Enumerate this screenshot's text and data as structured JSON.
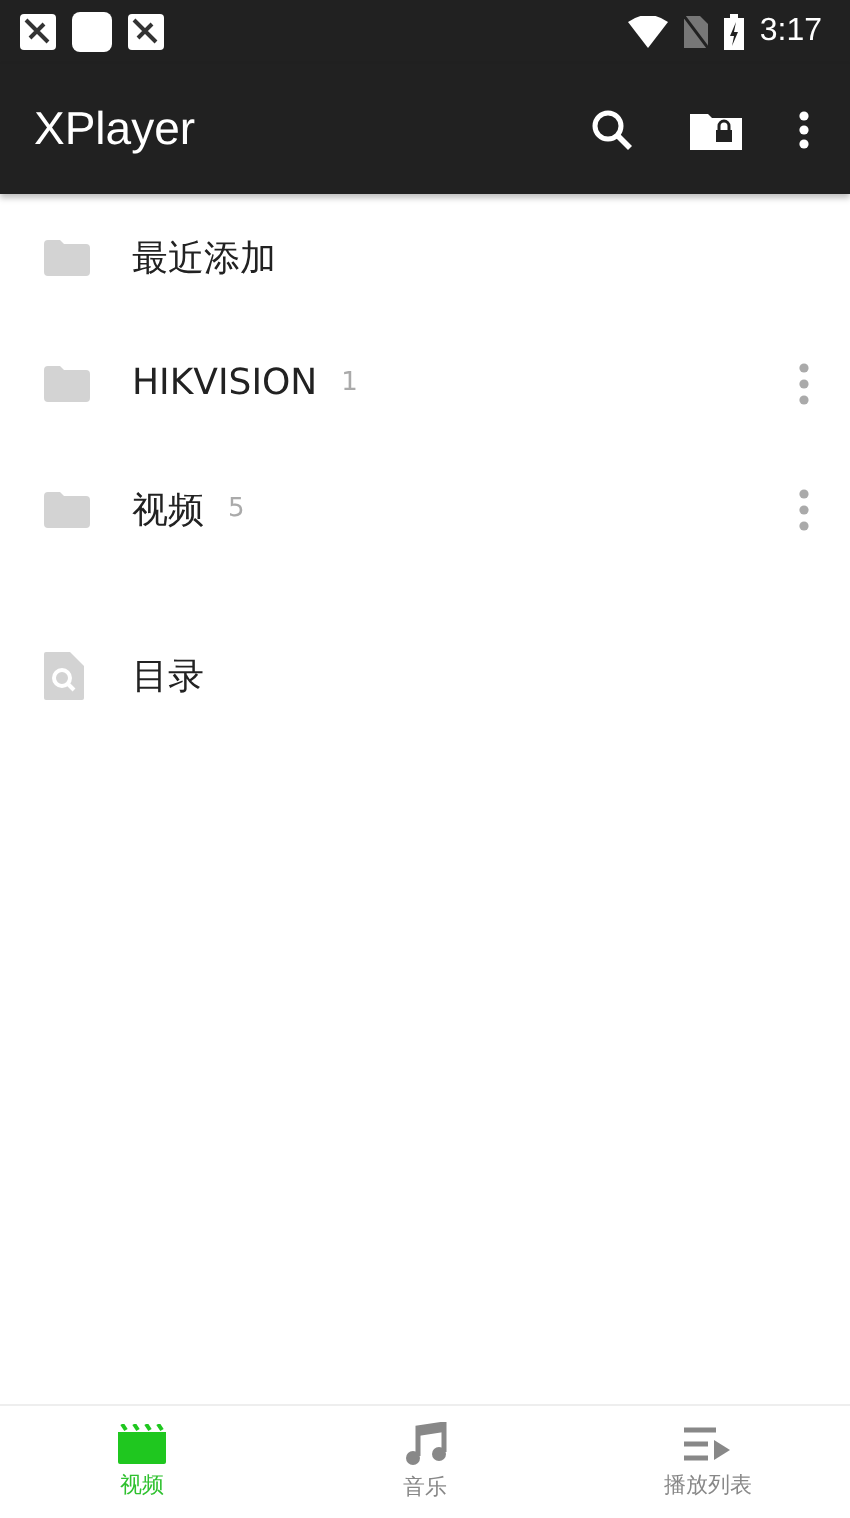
{
  "status_bar": {
    "time": "3:17"
  },
  "app_bar": {
    "title": "XPlayer"
  },
  "items": [
    {
      "kind": "folder",
      "label": "最近添加",
      "menu": false
    },
    {
      "kind": "folder",
      "label": "HIKVISION",
      "count": "1",
      "menu": true
    },
    {
      "kind": "folder",
      "label": "视频",
      "count": "5",
      "menu": true
    },
    {
      "kind": "directory",
      "label": "目录",
      "menu": false
    }
  ],
  "tabs": [
    {
      "kind": "video",
      "label": "视频",
      "selected": true
    },
    {
      "kind": "music",
      "label": "音乐",
      "selected": false
    },
    {
      "kind": "playlist",
      "label": "播放列表",
      "selected": false
    }
  ]
}
